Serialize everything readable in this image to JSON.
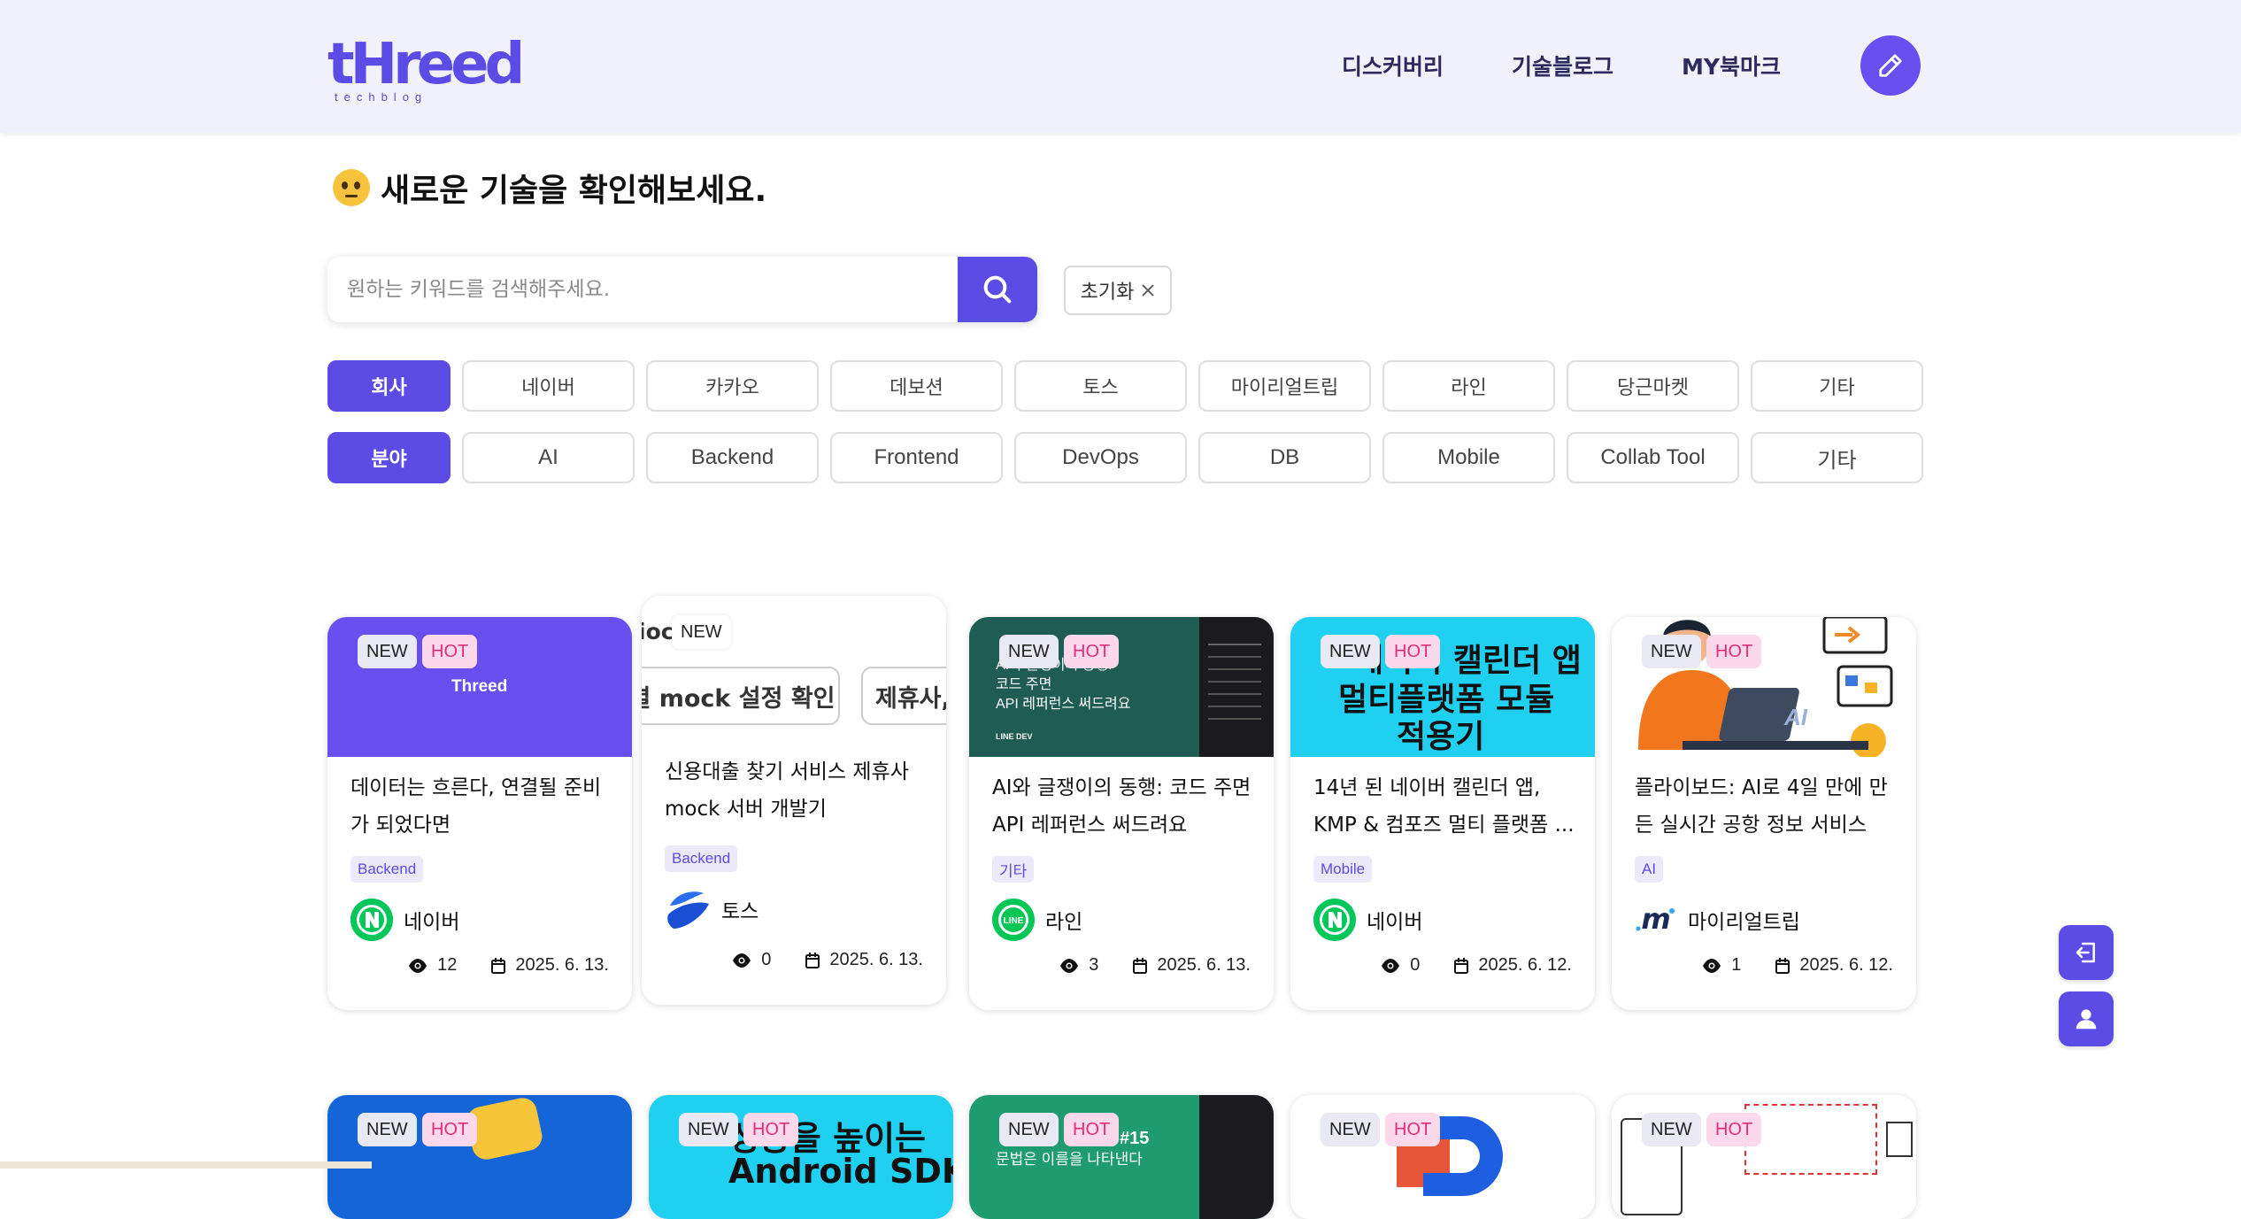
{
  "header": {
    "logo_main": "tHreed",
    "logo_sub": "techblog",
    "nav": [
      "디스커버리",
      "기술블로그",
      "MY북마크"
    ],
    "write_icon": "pencil-icon"
  },
  "page_heading": "새로운 기술을 확인해보세요.",
  "search": {
    "placeholder": "원하는 키워드를 검색해주세요.",
    "button_icon": "search-icon",
    "reset_label": "초기화"
  },
  "filters": {
    "company_label": "회사",
    "companies": [
      "네이버",
      "카카오",
      "데보션",
      "토스",
      "마이리얼트립",
      "라인",
      "당근마켓",
      "기타"
    ],
    "field_label": "분야",
    "fields": [
      "AI",
      "Backend",
      "Frontend",
      "DevOps",
      "DB",
      "Mobile",
      "Collab Tool",
      "기타"
    ]
  },
  "badges": {
    "new": "NEW",
    "hot": "HOT"
  },
  "cards": [
    {
      "title": "데이터는 흐른다, 연결될 준비가 되었다면",
      "tag": "Backend",
      "company": "네이버",
      "views": "12",
      "date": "2025. 6. 13.",
      "thumb_text": "Threed",
      "hot": true,
      "color": "#6a4ff0"
    },
    {
      "title": "신용대출 찾기 서비스 제휴사 mock 서버 개발기",
      "tag": "Backend",
      "company": "토스",
      "views": "0",
      "date": "2025. 6. 13.",
      "thumb_text": "별 mock 설정 확인",
      "thumb_text2": "제휴사, I",
      "thumb_text3": "ioc",
      "hot": false,
      "color": "#ffffff"
    },
    {
      "title": "AI와 글쟁이의 동행: 코드 주면 API 레퍼런스 써드려요",
      "tag": "기타",
      "company": "라인",
      "views": "3",
      "date": "2025. 6. 13.",
      "thumb_text": "AI와 글쟁이의 동행:",
      "thumb_text2": "코드 주면",
      "thumb_text3": "API 레퍼런스 써드려요",
      "thumb_text4": "LINE DEV",
      "hot": true,
      "color": "#1e5c54"
    },
    {
      "title": "14년 된 네이버 캘린더 앱, KMP & 컴포즈 멀티 플랫폼 ...",
      "tag": "Mobile",
      "company": "네이버",
      "views": "0",
      "date": "2025. 6. 12.",
      "thumb_text": "네이버 캘린더 앱",
      "thumb_text2": "멀티플랫폼 모듈",
      "thumb_text3": "적용기",
      "hot": true,
      "color": "#1fd0f0"
    },
    {
      "title": "플라이보드: AI로 4일 만에 만든 실시간 공항 정보 서비스",
      "tag": "AI",
      "company": "마이리얼트립",
      "views": "1",
      "date": "2025. 6. 12.",
      "thumb_text": "AI",
      "hot": true,
      "color": "#ffffff"
    }
  ],
  "cards_row2": [
    {
      "color": "#1466d8",
      "hot": true
    },
    {
      "color": "#1fd0f0",
      "hot": true,
      "thumb_text": "성능을 높이는",
      "thumb_text2": "Android SDK"
    },
    {
      "color": "#1e9c70",
      "hot": true,
      "thumb_text": "#15",
      "thumb_text2": "문법은 이름을 나타낸다"
    },
    {
      "color": "#ffffff",
      "hot": true
    },
    {
      "color": "#ffffff",
      "hot": true
    }
  ],
  "side_buttons": [
    "logout-icon",
    "user-icon"
  ],
  "colors": {
    "primary": "#5b4ce6",
    "hot": "#e02e7a",
    "header_bg": "#f1f1fb"
  }
}
